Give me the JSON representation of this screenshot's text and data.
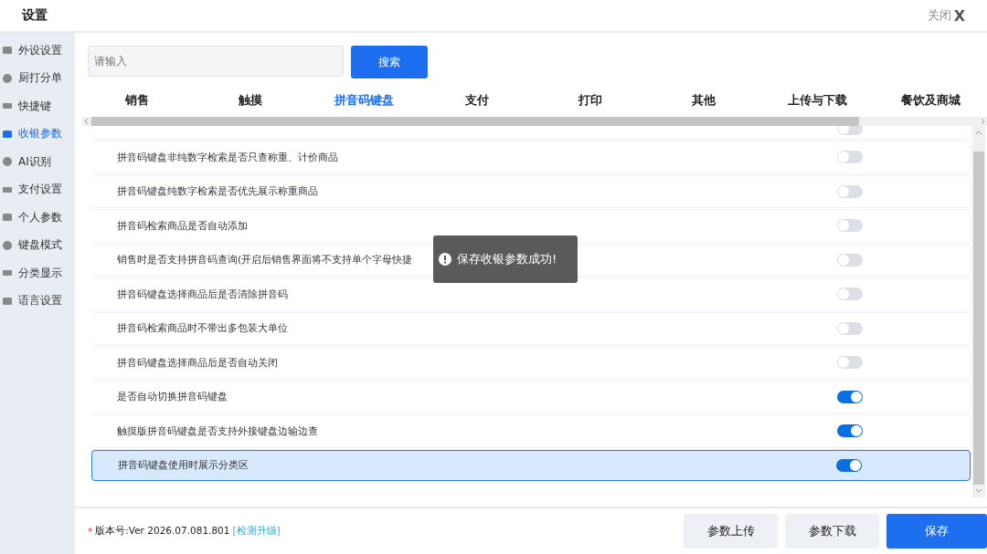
{
  "window": {
    "title": "设置",
    "close_label": "关闭",
    "close_icon": "X"
  },
  "sidebar": {
    "items": [
      {
        "label": "外设设置",
        "selected": false
      },
      {
        "label": "厨打分单",
        "selected": false
      },
      {
        "label": "快捷键",
        "selected": false
      },
      {
        "label": "收银参数",
        "selected": true
      },
      {
        "label": "AI识别",
        "selected": false
      },
      {
        "label": "支付设置",
        "selected": false
      },
      {
        "label": "个人参数",
        "selected": false
      },
      {
        "label": "键盘模式",
        "selected": false
      },
      {
        "label": "分类显示",
        "selected": false
      },
      {
        "label": "语言设置",
        "selected": false
      }
    ]
  },
  "search": {
    "placeholder": "请输入",
    "button": "搜索"
  },
  "tabs": [
    {
      "label": "销售",
      "selected": false
    },
    {
      "label": "触摸",
      "selected": false
    },
    {
      "label": "拼音码键盘",
      "selected": true
    },
    {
      "label": "支付",
      "selected": false
    },
    {
      "label": "打印",
      "selected": false
    },
    {
      "label": "其他",
      "selected": false
    },
    {
      "label": "上传与下载",
      "selected": false
    },
    {
      "label": "餐饮及商城",
      "selected": false
    }
  ],
  "settings": [
    {
      "on": false,
      "selected": false
    },
    {
      "label": "拼音码键盘非纯数字检索是否只查称重、计价商品",
      "on": false,
      "selected": false
    },
    {
      "label": "拼音码键盘纯数字检索是否优先展示称重商品",
      "on": false,
      "selected": false
    },
    {
      "label": "拼音码检索商品是否自动添加",
      "on": false,
      "selected": false
    },
    {
      "label": "销售时是否支持拼音码查询(开启后销售界面将不支持单个字母快捷",
      "on": false,
      "selected": false
    },
    {
      "label": "拼音码键盘选择商品后是否清除拼音码",
      "on": false,
      "selected": false
    },
    {
      "label": "拼音码检索商品时不带出多包装大单位",
      "on": false,
      "selected": false
    },
    {
      "label": "拼音码键盘选择商品后是否自动关闭",
      "on": false,
      "selected": false
    },
    {
      "label": "是否自动切换拼音码键盘",
      "on": true,
      "selected": false
    },
    {
      "label": "触摸版拼音码键盘是否支持外接键盘边输边查",
      "on": true,
      "selected": false
    },
    {
      "label": "拼音码键盘使用时展示分类区",
      "on": true,
      "selected": true
    }
  ],
  "toast": {
    "message": "保存收银参数成功!"
  },
  "footer": {
    "required_mark": "*",
    "version": "版本号:Ver 2026.07.081.801",
    "upgrade_link": "[检测升级]",
    "buttons": [
      "参数上传",
      "参数下载",
      "保存"
    ]
  }
}
